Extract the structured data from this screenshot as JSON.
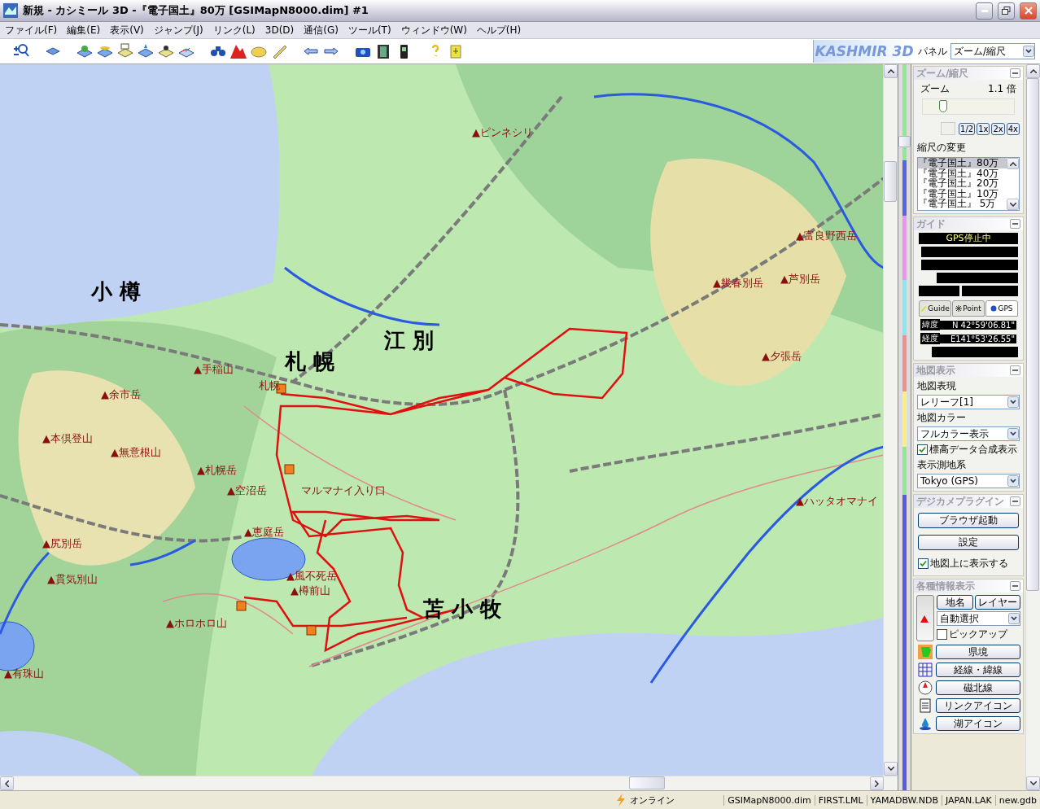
{
  "window": {
    "title": "新規 - カシミール 3D -『電子国土』80万 [GSIMapN8000.dim] #1"
  },
  "menu": [
    "ファイル(F)",
    "編集(E)",
    "表示(V)",
    "ジャンプ(J)",
    "リンク(L)",
    "3D(D)",
    "通信(G)",
    "ツール(T)",
    "ウィンドウ(W)",
    "ヘルプ(H)"
  ],
  "toolbar": {
    "logo": "KASHMIR 3D",
    "panel_label": "パネル",
    "panel_select": "ズーム/縮尺"
  },
  "map": {
    "labels": [
      {
        "kind": "peak",
        "text": "▲ピンネシリ"
      },
      {
        "kind": "peak",
        "text": "▲富良野西岳"
      },
      {
        "kind": "peak",
        "text": "▲幾春別岳"
      },
      {
        "kind": "peak",
        "text": "▲芦別岳"
      },
      {
        "kind": "city",
        "text": "小 樽"
      },
      {
        "kind": "city",
        "text": "江 別"
      },
      {
        "kind": "city",
        "text": "札 幌"
      },
      {
        "kind": "peak",
        "text": "▲夕張岳"
      },
      {
        "kind": "peak",
        "text": "▲手稲山"
      },
      {
        "kind": "peak",
        "text": "▲余市岳"
      },
      {
        "kind": "place",
        "text": "札幌"
      },
      {
        "kind": "peak",
        "text": "▲本倶登山"
      },
      {
        "kind": "peak",
        "text": "▲無意根山"
      },
      {
        "kind": "peak",
        "text": "▲札幌岳"
      },
      {
        "kind": "peak",
        "text": "▲空沼岳"
      },
      {
        "kind": "place",
        "text": "マルマナイ入り口"
      },
      {
        "kind": "peak",
        "text": "▲ハッタオマナイ"
      },
      {
        "kind": "peak",
        "text": "▲恵庭岳"
      },
      {
        "kind": "peak",
        "text": "▲尻別岳"
      },
      {
        "kind": "peak",
        "text": "▲風不死岳"
      },
      {
        "kind": "peak",
        "text": "▲樽前山"
      },
      {
        "kind": "peak",
        "text": "▲貫気別山"
      },
      {
        "kind": "peak",
        "text": "▲ホロホロ山"
      },
      {
        "kind": "city",
        "text": "苫 小 牧"
      },
      {
        "kind": "peak",
        "text": "▲有珠山"
      }
    ]
  },
  "panel": {
    "zoom": {
      "title": "ズーム/縮尺",
      "label": "ズーム",
      "value": "1.1 倍",
      "slider": {
        "level": 0.22
      },
      "scale_buttons": [
        "1/2",
        "1x",
        "2x",
        "4x"
      ],
      "scale_label": "縮尺の変更",
      "scales": [
        {
          "text": "『電子国土』80万",
          "selected": true
        },
        {
          "text": "『電子国土』40万",
          "selected": false
        },
        {
          "text": "『電子国土』20万",
          "selected": false
        },
        {
          "text": "『電子国土』10万",
          "selected": false
        },
        {
          "text": "『電子国土』 5万",
          "selected": false
        }
      ]
    },
    "guide": {
      "title": "ガイド",
      "status": "GPS停止中",
      "tabs": [
        {
          "label": "Guide",
          "selected": false
        },
        {
          "label": "Point",
          "selected": false
        },
        {
          "label": "GPS",
          "selected": true
        }
      ],
      "coords": [
        {
          "label": "緯度",
          "value": "N 42°59'06.81\""
        },
        {
          "label": "経度",
          "value": "E141°53'26.55\""
        }
      ]
    },
    "map_display": {
      "title": "地図表示",
      "fields": [
        {
          "label": "地図表現",
          "value": "レリーフ[1]"
        },
        {
          "label": "地図カラー",
          "value": "フルカラー表示"
        }
      ],
      "elevation": {
        "label": "標高データ合成表示",
        "checked": true
      },
      "datum": {
        "label": "表示測地系",
        "value": "Tokyo (GPS)"
      }
    },
    "camera": {
      "title": "デジカメプラグイン",
      "buttons": [
        "ブラウザ起動",
        "設定"
      ],
      "show_on_map": {
        "label": "地図上に表示する",
        "checked": true
      }
    },
    "info": {
      "title": "各種情報表示",
      "buttons": [
        "地名",
        "レイヤー"
      ],
      "select": "自動選択",
      "pickup": {
        "label": "ピックアップ",
        "checked": false
      },
      "rows": [
        {
          "kind": "border",
          "label": "県境"
        },
        {
          "kind": "grid",
          "label": "経線・緯線"
        },
        {
          "kind": "compass",
          "label": "磁北線"
        },
        {
          "kind": "doc",
          "label": "リンクアイコン"
        },
        {
          "kind": "lake",
          "label": "湖アイコン"
        }
      ]
    }
  },
  "status_bar": {
    "online": "オンライン",
    "files": [
      "GSIMapN8000.dim",
      "FIRST.LML",
      "YAMADBW.NDB",
      "JAPAN.LAK",
      "new.gdb"
    ]
  }
}
